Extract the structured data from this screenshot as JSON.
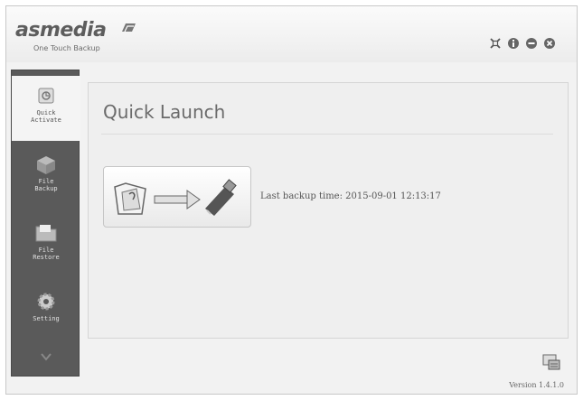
{
  "header": {
    "brand": "asmedia",
    "tagline": "One Touch Backup"
  },
  "window_controls": [
    {
      "name": "restore",
      "icon": "restore-icon"
    },
    {
      "name": "info",
      "icon": "info-icon"
    },
    {
      "name": "minimize",
      "icon": "minimize-icon"
    },
    {
      "name": "close",
      "icon": "close-icon"
    }
  ],
  "sidebar": {
    "items": [
      {
        "label": "Quick\nActivate",
        "icon": "quick-launch-icon",
        "active": true
      },
      {
        "label": "File\nBackup",
        "icon": "file-backup-icon",
        "active": false
      },
      {
        "label": "File\nRestore",
        "icon": "file-restore-icon",
        "active": false
      },
      {
        "label": "Setting",
        "icon": "gear-icon",
        "active": false
      }
    ]
  },
  "main": {
    "title": "Quick Launch",
    "last_backup": "Last backup time: 2015-09-01 12:13:17"
  },
  "footer": {
    "version": "Version 1.4.1.0"
  },
  "colors": {
    "sidebar_bg": "#5a5a5a",
    "main_bg": "#efefef",
    "text_gray": "#6b6b6b"
  }
}
